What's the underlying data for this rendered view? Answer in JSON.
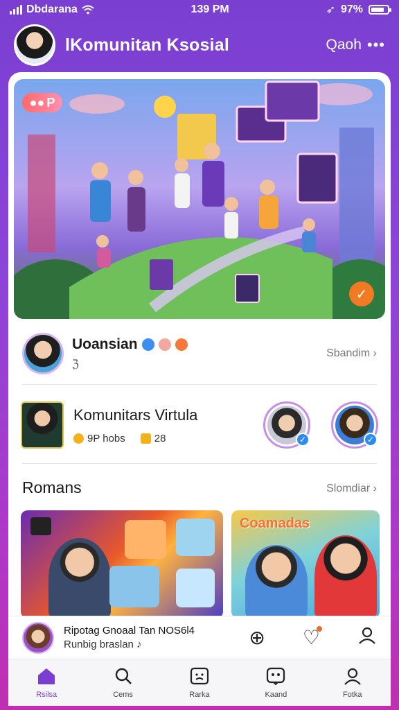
{
  "status_bar": {
    "carrier": "Dbdarana",
    "time": "139 PM",
    "battery": "97%"
  },
  "header": {
    "title": "lKomunitan Ksosial",
    "action_label": "Qaoh"
  },
  "hero": {
    "bubble_text": "P"
  },
  "featured_user": {
    "name": "Uoansian",
    "sub": "ℨ",
    "link": "Sbandim"
  },
  "community": {
    "title": "Komunitars Virtula",
    "meta1": "9P hobs",
    "meta2": "28"
  },
  "section": {
    "title": "Romans",
    "link": "Slomdiar"
  },
  "tiles": [
    {
      "title": ""
    },
    {
      "title": "Coamadas"
    }
  ],
  "now_playing": {
    "title": "Ripotag Gnoaal Tan NOS6l4",
    "sub": "Runbig braslan"
  },
  "tabs": [
    {
      "label": "Rsilsa",
      "icon": "home-icon"
    },
    {
      "label": "Cems",
      "icon": "search-icon"
    },
    {
      "label": "Rarka",
      "icon": "face-frame-icon"
    },
    {
      "label": "Kaand",
      "icon": "chat-face-icon"
    },
    {
      "label": "Fotka",
      "icon": "profile-icon"
    }
  ],
  "colors": {
    "accent": "#7a3fd1",
    "verified": "#2d8cf0",
    "badge": "#f06a2a"
  }
}
